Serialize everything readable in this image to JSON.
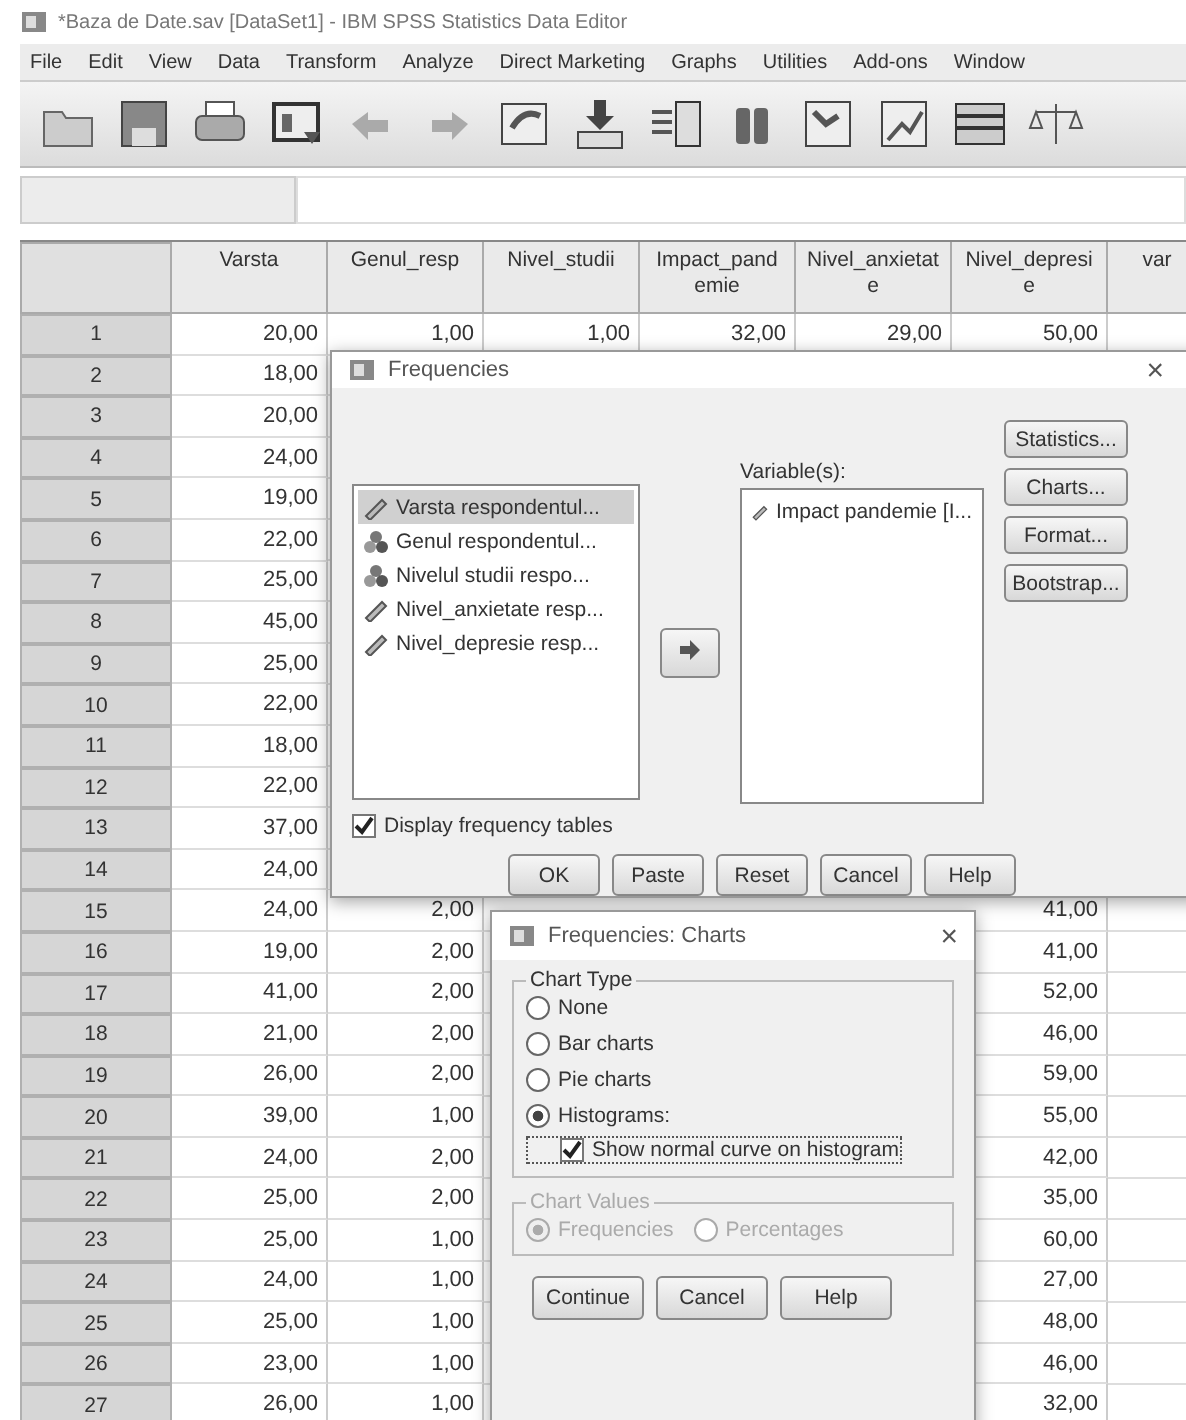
{
  "window": {
    "title": "*Baza de Date.sav [DataSet1] - IBM SPSS Statistics Data Editor"
  },
  "menu": [
    "File",
    "Edit",
    "View",
    "Data",
    "Transform",
    "Analyze",
    "Direct Marketing",
    "Graphs",
    "Utilities",
    "Add-ons",
    "Window"
  ],
  "table": {
    "columns": [
      {
        "lines": [
          "Varsta"
        ]
      },
      {
        "lines": [
          "Genul_resp"
        ]
      },
      {
        "lines": [
          "Nivel_studii"
        ]
      },
      {
        "lines": [
          "Impact_pand",
          "emie"
        ]
      },
      {
        "lines": [
          "Nivel_anxietat",
          "e"
        ]
      },
      {
        "lines": [
          "Nivel_depresi",
          "e"
        ]
      },
      {
        "lines": [
          "var"
        ]
      }
    ],
    "rows": [
      {
        "number": "1",
        "varsta": "20,00",
        "genul_resp": "1,00",
        "nivel_studii": "1,00",
        "impact_pandemie": "32,00",
        "nivel_anxietate": "29,00",
        "nivel_depresie": "50,00"
      },
      {
        "number": "2",
        "varsta": "18,00"
      },
      {
        "number": "3",
        "varsta": "20,00"
      },
      {
        "number": "4",
        "varsta": "24,00"
      },
      {
        "number": "5",
        "varsta": "19,00"
      },
      {
        "number": "6",
        "varsta": "22,00"
      },
      {
        "number": "7",
        "varsta": "25,00"
      },
      {
        "number": "8",
        "varsta": "45,00"
      },
      {
        "number": "9",
        "varsta": "25,00"
      },
      {
        "number": "10",
        "varsta": "22,00"
      },
      {
        "number": "11",
        "varsta": "18,00"
      },
      {
        "number": "12",
        "varsta": "22,00"
      },
      {
        "number": "13",
        "varsta": "37,00"
      },
      {
        "number": "14",
        "varsta": "24,00"
      },
      {
        "number": "15",
        "varsta": "24,00",
        "genul_resp": "2,00",
        "nivel_depresie": "41,00"
      },
      {
        "number": "16",
        "varsta": "19,00",
        "genul_resp": "2,00",
        "nivel_depresie": "41,00"
      },
      {
        "number": "17",
        "varsta": "41,00",
        "genul_resp": "2,00",
        "nivel_depresie": "52,00"
      },
      {
        "number": "18",
        "varsta": "21,00",
        "genul_resp": "2,00",
        "nivel_depresie": "46,00"
      },
      {
        "number": "19",
        "varsta": "26,00",
        "genul_resp": "2,00",
        "nivel_depresie": "59,00"
      },
      {
        "number": "20",
        "varsta": "39,00",
        "genul_resp": "1,00",
        "nivel_depresie": "55,00"
      },
      {
        "number": "21",
        "varsta": "24,00",
        "genul_resp": "2,00",
        "nivel_depresie": "42,00"
      },
      {
        "number": "22",
        "varsta": "25,00",
        "genul_resp": "2,00",
        "nivel_depresie": "35,00"
      },
      {
        "number": "23",
        "varsta": "25,00",
        "genul_resp": "1,00",
        "nivel_depresie": "60,00"
      },
      {
        "number": "24",
        "varsta": "24,00",
        "genul_resp": "1,00",
        "nivel_depresie": "27,00"
      },
      {
        "number": "25",
        "varsta": "25,00",
        "genul_resp": "1,00",
        "nivel_depresie": "48,00"
      },
      {
        "number": "26",
        "varsta": "23,00",
        "genul_resp": "1,00",
        "nivel_depresie": "46,00"
      },
      {
        "number": "27",
        "varsta": "26,00",
        "genul_resp": "1,00",
        "nivel_depresie": "32,00"
      }
    ]
  },
  "frequencies_dialog": {
    "title": "Frequencies",
    "close": "×",
    "source_list": [
      {
        "label": "Varsta respondentul...",
        "kind": "scale",
        "selected": true
      },
      {
        "label": "Genul respondentul...",
        "kind": "nominal",
        "selected": false
      },
      {
        "label": "Nivelul studii respo...",
        "kind": "nominal",
        "selected": false
      },
      {
        "label": "Nivel_anxietate resp...",
        "kind": "scale",
        "selected": false
      },
      {
        "label": "Nivel_depresie resp...",
        "kind": "scale",
        "selected": false
      }
    ],
    "variables_label": "Variable(s):",
    "variables": [
      {
        "label": "Impact pandemie [I...",
        "kind": "scale",
        "selected": false
      }
    ],
    "side_buttons": [
      "Statistics...",
      "Charts...",
      "Format...",
      "Bootstrap..."
    ],
    "display_tables": {
      "label": "Display frequency tables",
      "checked": true
    },
    "buttons": [
      "OK",
      "Paste",
      "Reset",
      "Cancel",
      "Help"
    ]
  },
  "charts_dialog": {
    "title": "Frequencies: Charts",
    "close": "×",
    "chart_type": {
      "legend": "Chart Type",
      "disabled": false,
      "options": [
        {
          "label": "None",
          "selected": false
        },
        {
          "label": "Bar charts",
          "selected": false
        },
        {
          "label": "Pie charts",
          "selected": false
        },
        {
          "label": "Histograms:",
          "selected": true
        }
      ]
    },
    "normal_curve": {
      "label": "Show normal curve on histogram",
      "checked": true
    },
    "chart_values": {
      "legend": "Chart Values",
      "disabled": true,
      "options": [
        {
          "label": "Frequencies",
          "selected": true
        },
        {
          "label": "Percentages",
          "selected": false
        }
      ]
    },
    "buttons": [
      "Continue",
      "Cancel",
      "Help"
    ]
  }
}
